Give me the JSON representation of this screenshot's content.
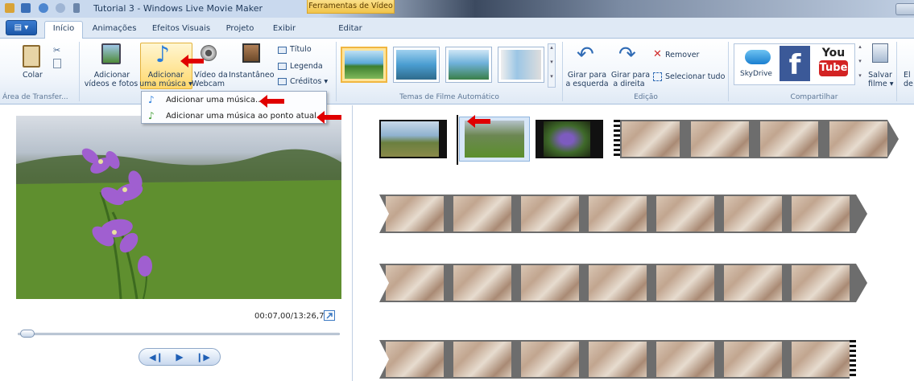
{
  "window": {
    "title": "Tutorial 3 - Windows Live Movie Maker",
    "context_tab": "Ferramentas de Vídeo"
  },
  "tabs": [
    {
      "label": "Início"
    },
    {
      "label": "Animações"
    },
    {
      "label": "Efeitos Visuais"
    },
    {
      "label": "Projeto"
    },
    {
      "label": "Exibir"
    },
    {
      "label": "Editar"
    }
  ],
  "ribbon": {
    "clipboard": {
      "paste": "Colar",
      "group": "Área de Transfer..."
    },
    "add": {
      "add_videos_l1": "Adicionar",
      "add_videos_l2": "vídeos e fotos",
      "add_music_l1": "Adicionar",
      "add_music_l2": "uma música",
      "webcam_l1": "Vídeo da",
      "webcam_l2": "Webcam",
      "snapshot": "Instantâneo",
      "title": "Título",
      "caption": "Legenda",
      "credits": "Créditos"
    },
    "themes": {
      "group": "Temas de Filme Automático"
    },
    "editing": {
      "rotate_left_l1": "Girar para",
      "rotate_left_l2": "a esquerda",
      "rotate_right_l1": "Girar para",
      "rotate_right_l2": "a direita",
      "remove": "Remover",
      "select_all": "Selecionar tudo",
      "group": "Edição"
    },
    "share": {
      "skydrive": "SkyDrive",
      "youtube_top": "You",
      "youtube_bottom": "Tube",
      "save_l1": "Salvar",
      "save_l2": "filme",
      "group": "Compartilhar",
      "cut_label": "El",
      "cut_label2": "de"
    }
  },
  "menu": {
    "items": [
      {
        "label": "Adicionar uma música..."
      },
      {
        "label": "Adicionar uma música ao ponto atual..."
      }
    ]
  },
  "preview": {
    "timecode": "00:07,00/13:26,73",
    "progress": 0.009
  },
  "colors": {
    "accent": "#1e395b",
    "arrow": "#e00000",
    "file_button": "#2a6bc4"
  }
}
